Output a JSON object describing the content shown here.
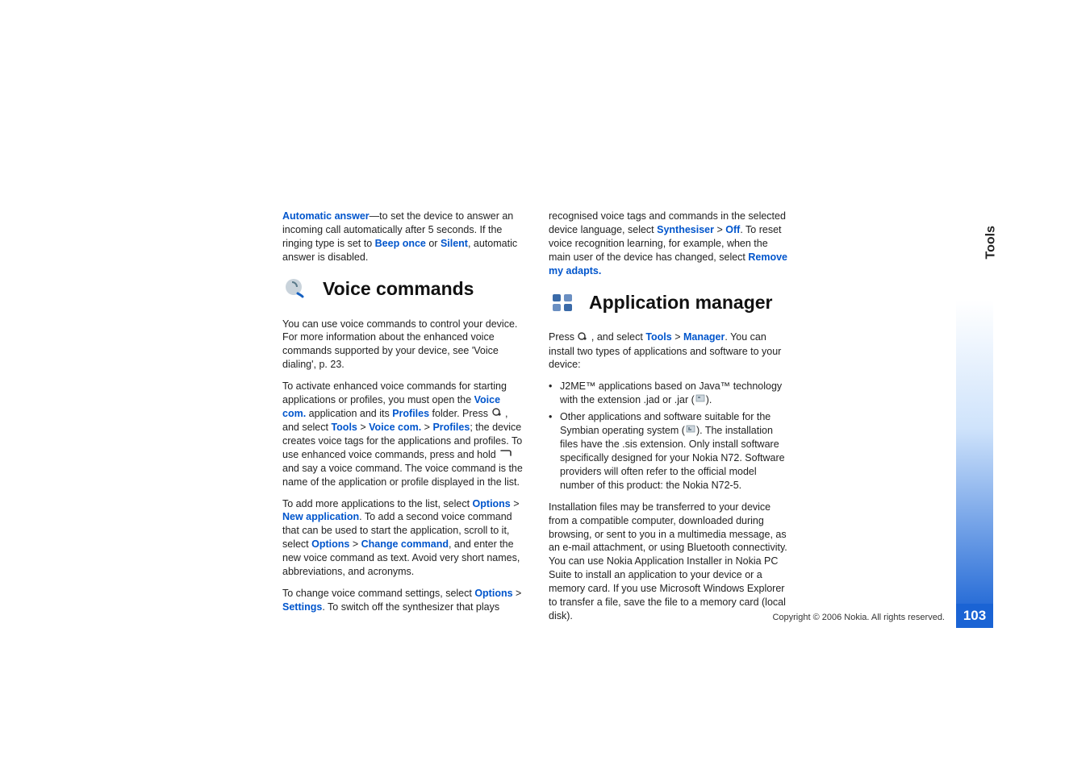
{
  "sideTab": "Tools",
  "pageNumber": "103",
  "copyright": "Copyright © 2006 Nokia. All rights reserved.",
  "left": {
    "p1_a": "Automatic answer",
    "p1_b": "—to set the device to answer an incoming call automatically after 5 seconds. If the ringing type is set to ",
    "p1_c": "Beep once",
    "p1_d": " or ",
    "p1_e": "Silent",
    "p1_f": ", automatic answer is disabled.",
    "h1": "Voice commands",
    "p2": "You can use voice commands to control your device. For more information about the enhanced voice commands supported by your device, see 'Voice dialing', p. 23.",
    "p3_a": "To activate enhanced voice commands for starting applications or profiles, you must open the ",
    "p3_b": "Voice com.",
    "p3_c": " application and its ",
    "p3_d": "Profiles",
    "p3_e": " folder. Press ",
    "p3_f": " , and select ",
    "p3_g": "Tools",
    "p3_h": " > ",
    "p3_i": "Voice com.",
    "p3_j": " > ",
    "p3_k": "Profiles",
    "p3_l": "; the device creates voice tags for the applications and profiles. To use enhanced voice commands, press and hold ",
    "p3_m": " and say a voice command. The voice command is the name of the application or profile displayed in the list.",
    "p4_a": "To add more applications to the list, select ",
    "p4_b": "Options",
    "p4_c": " > ",
    "p4_d": "New application",
    "p4_e": ". To add a second voice command that can be used to start the application, scroll to it, select ",
    "p4_f": "Options",
    "p4_g": " > ",
    "p4_h": "Change command",
    "p4_i": ", and enter the new voice command as text. Avoid very short names, abbreviations, and acronyms.",
    "p5_a": "To change voice command settings, select ",
    "p5_b": "Options",
    "p5_c": " > ",
    "p5_d": "Settings",
    "p5_e": ". To switch off the synthesizer that plays"
  },
  "right": {
    "p1_a": "recognised voice tags and commands in the selected device language, select ",
    "p1_b": "Synthesiser",
    "p1_c": " > ",
    "p1_d": "Off",
    "p1_e": ". To reset voice recognition learning, for example, when the main user of the device has changed, select ",
    "p1_f": "Remove my adapts.",
    "h1": "Application manager",
    "p2_a": "Press ",
    "p2_b": " , and select ",
    "p2_c": "Tools",
    "p2_d": " > ",
    "p2_e": "Manager",
    "p2_f": ". You can install two types of applications and software to your device:",
    "li1_a": "J2ME™ applications based on Java™ technology with the extension .jad or .jar (",
    "li1_b": ").",
    "li2_a": "Other applications and software suitable for the Symbian operating system (",
    "li2_b": "). The installation files have the .sis extension. Only install software specifically designed for your Nokia N72. Software providers will often refer to the official model number of this product: the Nokia N72-5.",
    "p3": "Installation files may be transferred to your device from a compatible computer, downloaded during browsing, or sent to you in a multimedia message, as an e-mail attachment, or using Bluetooth connectivity. You can use Nokia Application Installer in Nokia PC Suite to install an application to your device or a memory card. If you use Microsoft Windows Explorer to transfer a file, save the file to a memory card (local disk)."
  }
}
